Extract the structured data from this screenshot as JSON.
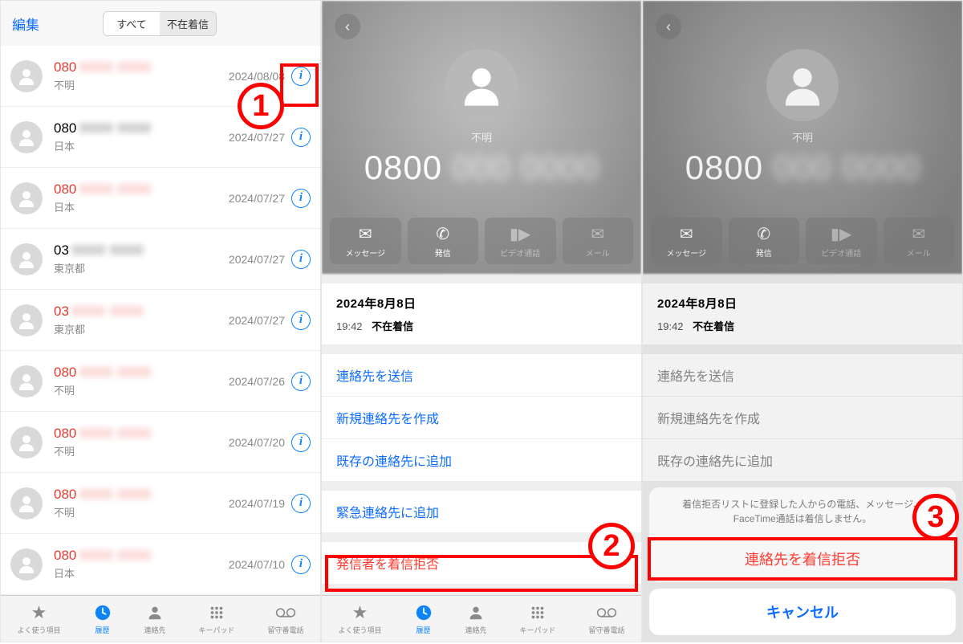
{
  "panel1": {
    "edit": "編集",
    "seg_all": "すべて",
    "seg_missed": "不在着信",
    "rows": [
      {
        "num": "080",
        "missed": true,
        "sub": "不明",
        "date": "2024/08/08"
      },
      {
        "num": "080",
        "missed": false,
        "sub": "日本",
        "date": "2024/07/27"
      },
      {
        "num": "080",
        "missed": true,
        "sub": "日本",
        "date": "2024/07/27"
      },
      {
        "num": "03",
        "missed": false,
        "sub": "東京都",
        "date": "2024/07/27"
      },
      {
        "num": "03",
        "missed": true,
        "sub": "東京都",
        "date": "2024/07/27"
      },
      {
        "num": "080",
        "missed": true,
        "sub": "不明",
        "date": "2024/07/26"
      },
      {
        "num": "080",
        "missed": true,
        "sub": "不明",
        "date": "2024/07/20"
      },
      {
        "num": "080",
        "missed": true,
        "sub": "不明",
        "date": "2024/07/19"
      },
      {
        "num": "080",
        "missed": true,
        "sub": "日本",
        "date": "2024/07/10"
      }
    ]
  },
  "tabs": {
    "favorites": "よく使う項目",
    "recents": "履歴",
    "contacts": "連絡先",
    "keypad": "キーパッド",
    "voicemail": "留守番電話"
  },
  "detail": {
    "name": "不明",
    "number_prefix": "0800",
    "act_message": "メッセージ",
    "act_call": "発信",
    "act_video": "ビデオ通話",
    "act_mail": "メール",
    "call_date": "2024年8月8日",
    "call_time": "19:42",
    "call_type": "不在着信",
    "share": "連絡先を送信",
    "create": "新規連絡先を作成",
    "add_existing": "既存の連絡先に追加",
    "emergency": "緊急連絡先に追加",
    "block": "発信者を着信拒否"
  },
  "sheet": {
    "note": "着信拒否リストに登録した人からの電話、メッセージ、FaceTime通話は着信しません。",
    "block": "連絡先を着信拒否",
    "cancel": "キャンセル"
  },
  "badges": {
    "b1": "1",
    "b2": "2",
    "b3": "3"
  }
}
